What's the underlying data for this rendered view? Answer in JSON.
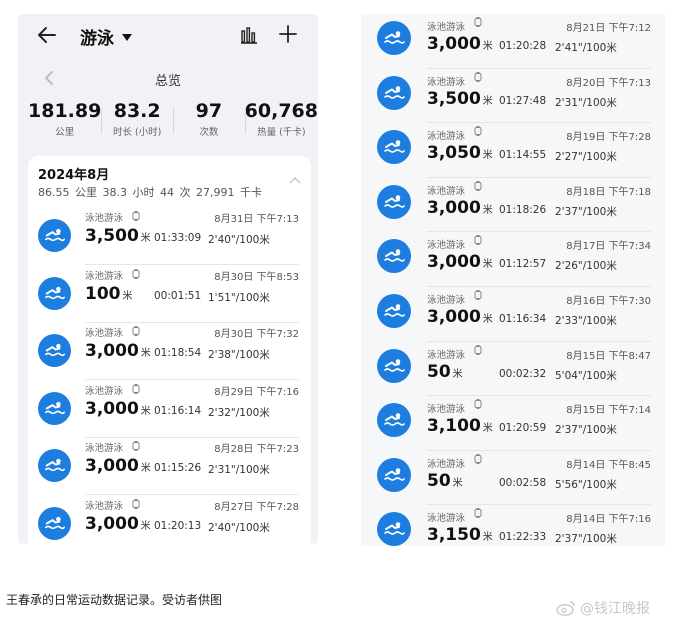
{
  "left_screen": {
    "title": "游泳",
    "overview_label": "总览",
    "stats": [
      {
        "value": "181.89",
        "label": "公里"
      },
      {
        "value": "83.2",
        "label": "时长 (小时)"
      },
      {
        "value": "97",
        "label": "次数"
      },
      {
        "value": "60,768",
        "label": "热量 (千卡)"
      }
    ],
    "month": {
      "title": "2024年8月",
      "summary": "86.55 公里   38.3 小时   44 次   27,991 千卡"
    },
    "records": [
      {
        "kind": "泳池游泳",
        "date": "8月31日 下午7:13",
        "distance": "3,500",
        "unit": "米",
        "duration": "01:33:09",
        "pace": "2'40\"/100米"
      },
      {
        "kind": "泳池游泳",
        "date": "8月30日 下午8:53",
        "distance": "100",
        "unit": "米",
        "duration": "00:01:51",
        "pace": "1'51\"/100米"
      },
      {
        "kind": "泳池游泳",
        "date": "8月30日 下午7:32",
        "distance": "3,000",
        "unit": "米",
        "duration": "01:18:54",
        "pace": "2'38\"/100米"
      },
      {
        "kind": "泳池游泳",
        "date": "8月29日 下午7:16",
        "distance": "3,000",
        "unit": "米",
        "duration": "01:16:14",
        "pace": "2'32\"/100米"
      },
      {
        "kind": "泳池游泳",
        "date": "8月28日 下午7:23",
        "distance": "3,000",
        "unit": "米",
        "duration": "01:15:26",
        "pace": "2'31\"/100米"
      },
      {
        "kind": "泳池游泳",
        "date": "8月27日 下午7:28",
        "distance": "3,000",
        "unit": "米",
        "duration": "01:20:13",
        "pace": "2'40\"/100米"
      }
    ]
  },
  "right_screen": {
    "records": [
      {
        "kind": "泳池游泳",
        "date": "8月21日 下午7:12",
        "distance": "3,000",
        "unit": "米",
        "duration": "01:20:28",
        "pace": "2'41\"/100米"
      },
      {
        "kind": "泳池游泳",
        "date": "8月20日 下午7:13",
        "distance": "3,500",
        "unit": "米",
        "duration": "01:27:48",
        "pace": "2'31\"/100米"
      },
      {
        "kind": "泳池游泳",
        "date": "8月19日 下午7:28",
        "distance": "3,050",
        "unit": "米",
        "duration": "01:14:55",
        "pace": "2'27\"/100米"
      },
      {
        "kind": "泳池游泳",
        "date": "8月18日 下午7:18",
        "distance": "3,000",
        "unit": "米",
        "duration": "01:18:26",
        "pace": "2'37\"/100米"
      },
      {
        "kind": "泳池游泳",
        "date": "8月17日 下午7:34",
        "distance": "3,000",
        "unit": "米",
        "duration": "01:12:57",
        "pace": "2'26\"/100米"
      },
      {
        "kind": "泳池游泳",
        "date": "8月16日 下午7:30",
        "distance": "3,000",
        "unit": "米",
        "duration": "01:16:34",
        "pace": "2'33\"/100米"
      },
      {
        "kind": "泳池游泳",
        "date": "8月15日 下午8:47",
        "distance": "50",
        "unit": "米",
        "duration": "00:02:32",
        "pace": "5'04\"/100米"
      },
      {
        "kind": "泳池游泳",
        "date": "8月15日 下午7:14",
        "distance": "3,100",
        "unit": "米",
        "duration": "01:20:59",
        "pace": "2'37\"/100米"
      },
      {
        "kind": "泳池游泳",
        "date": "8月14日 下午8:45",
        "distance": "50",
        "unit": "米",
        "duration": "00:02:58",
        "pace": "5'56\"/100米"
      },
      {
        "kind": "泳池游泳",
        "date": "8月14日 下午7:16",
        "distance": "3,150",
        "unit": "米",
        "duration": "01:22:33",
        "pace": "2'37\"/100米"
      }
    ]
  },
  "caption": "王春承的日常运动数据记录。受访者供图",
  "watermark": "@钱江晚报",
  "icons": {
    "back": "back-arrow-icon",
    "chart": "bar-chart-icon",
    "add": "plus-icon",
    "swim": "swimmer-icon",
    "watch": "watch-icon",
    "collapse": "chevron-up-icon",
    "weibo": "weibo-logo-icon"
  },
  "colors": {
    "accent": "#1d7ee0",
    "screen_bg": "#f1f2f5"
  }
}
